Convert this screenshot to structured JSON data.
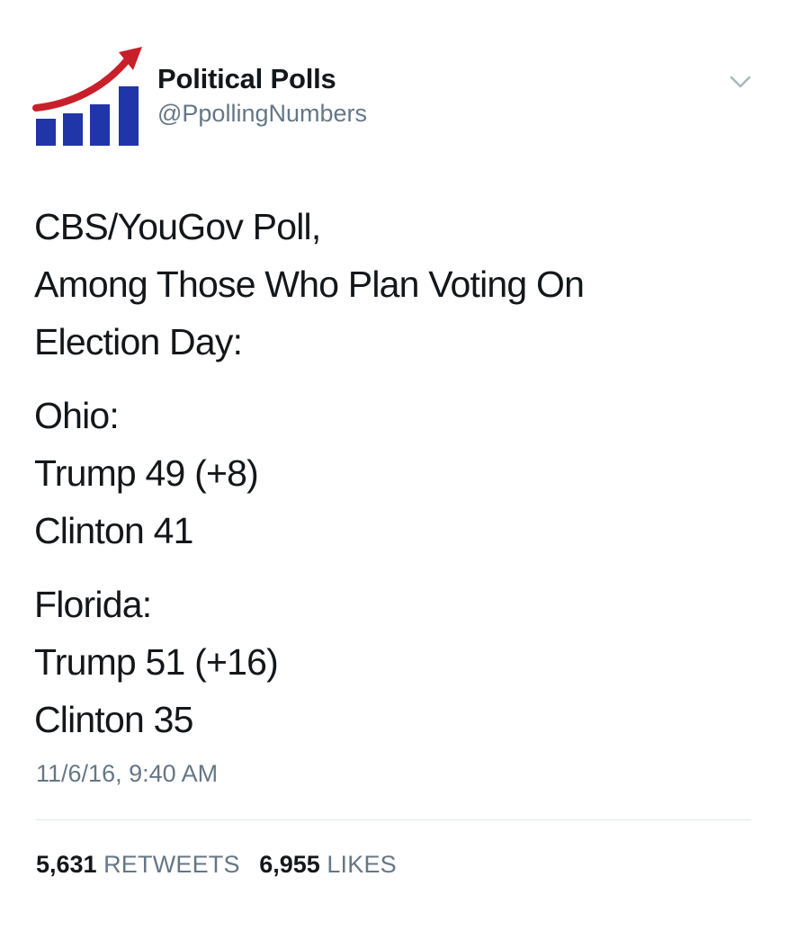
{
  "author": {
    "name": "Political Polls",
    "handle": "@PpollingNumbers",
    "avatar_icon": "rising-bar-chart-icon"
  },
  "colors": {
    "avatar_bars": "#1f35a8",
    "avatar_arrow": "#c8202a",
    "secondary_text": "#657786",
    "divider": "#e1e8ed"
  },
  "tweet": {
    "paragraphs": [
      [
        "CBS/YouGov Poll,",
        "Among Those Who Plan Voting On",
        "Election Day:"
      ],
      [
        "Ohio:",
        "Trump 49 (+8)",
        "Clinton 41"
      ],
      [
        "Florida:",
        "Trump 51 (+16)",
        "Clinton 35"
      ]
    ],
    "timestamp": "11/6/16, 9:40 AM"
  },
  "stats": {
    "retweets_count": "5,631",
    "retweets_label": "RETWEETS",
    "likes_count": "6,955",
    "likes_label": "LIKES"
  }
}
